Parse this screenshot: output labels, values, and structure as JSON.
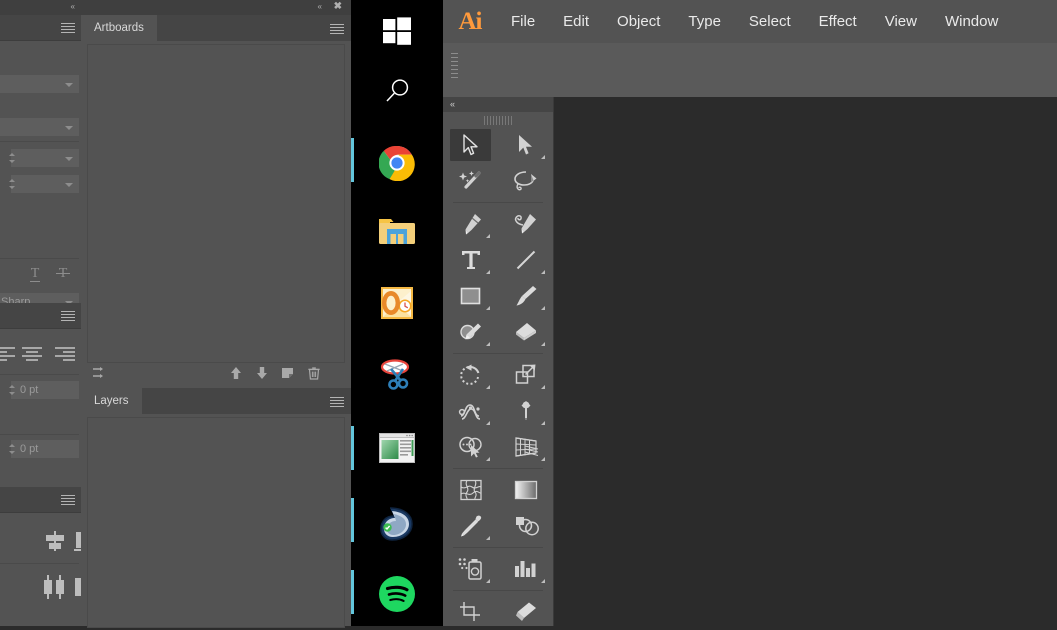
{
  "window": {
    "app_title": "Adobe Illustrator",
    "collapse_arrows": "«",
    "close_glyph": "✖"
  },
  "menubar": {
    "logo_text": "Ai",
    "items": [
      {
        "label": "File"
      },
      {
        "label": "Edit"
      },
      {
        "label": "Object"
      },
      {
        "label": "Type"
      },
      {
        "label": "Select"
      },
      {
        "label": "Effect"
      },
      {
        "label": "View"
      },
      {
        "label": "Window"
      }
    ]
  },
  "panel_group": {
    "tabs": [
      {
        "label": "Artboards",
        "active": true
      },
      {
        "label": "Layers",
        "active": true
      }
    ],
    "artboards_footer_icons": [
      {
        "name": "rearrange-artboards-icon"
      },
      {
        "name": "move-up-icon"
      },
      {
        "name": "move-down-icon"
      },
      {
        "name": "new-artboard-icon"
      },
      {
        "name": "delete-artboard-icon"
      }
    ]
  },
  "character_panel": {
    "font_family_value": "",
    "font_style_value": "",
    "font_size_value": "",
    "leading_value": "",
    "antialias_value": "Sharp",
    "underline_glyph": "T",
    "strikethrough_glyph": "T"
  },
  "paragraph_panel": {
    "indent_value": "0 pt",
    "space_value": "0 pt",
    "align_icons": [
      {
        "name": "align-left-icon"
      },
      {
        "name": "align-center-icon"
      },
      {
        "name": "align-right-icon"
      }
    ]
  },
  "align_panel": {
    "icons": [
      {
        "name": "horizontal-align-center-icon"
      },
      {
        "name": "vertical-align-bottom-icon"
      },
      {
        "name": "horizontal-distribute-center-icon"
      },
      {
        "name": "horizontal-distribute-space-icon"
      }
    ]
  },
  "toolbox": {
    "collapse_glyph": "«",
    "tools": [
      {
        "name": "selection-tool",
        "active": true,
        "has_flyout": false
      },
      {
        "name": "direct-selection-tool",
        "active": false,
        "has_flyout": true
      },
      {
        "name": "magic-wand-tool",
        "active": false,
        "has_flyout": false
      },
      {
        "name": "lasso-tool",
        "active": false,
        "has_flyout": false
      },
      {
        "name": "pen-tool",
        "active": false,
        "has_flyout": true
      },
      {
        "name": "curvature-tool",
        "active": false,
        "has_flyout": false
      },
      {
        "name": "type-tool",
        "active": false,
        "has_flyout": true
      },
      {
        "name": "line-segment-tool",
        "active": false,
        "has_flyout": true
      },
      {
        "name": "rectangle-tool",
        "active": false,
        "has_flyout": true
      },
      {
        "name": "paintbrush-tool",
        "active": false,
        "has_flyout": true
      },
      {
        "name": "shaper-tool",
        "active": false,
        "has_flyout": true
      },
      {
        "name": "eraser-tool",
        "active": false,
        "has_flyout": true
      },
      {
        "name": "rotate-tool",
        "active": false,
        "has_flyout": true
      },
      {
        "name": "scale-tool",
        "active": false,
        "has_flyout": true
      },
      {
        "name": "width-tool",
        "active": false,
        "has_flyout": true
      },
      {
        "name": "free-transform-tool",
        "active": false,
        "has_flyout": true
      },
      {
        "name": "shape-builder-tool",
        "active": false,
        "has_flyout": true
      },
      {
        "name": "perspective-grid-tool",
        "active": false,
        "has_flyout": true
      },
      {
        "name": "mesh-tool",
        "active": false,
        "has_flyout": false
      },
      {
        "name": "gradient-tool",
        "active": false,
        "has_flyout": false
      },
      {
        "name": "eyedropper-tool",
        "active": false,
        "has_flyout": true
      },
      {
        "name": "blend-tool",
        "active": false,
        "has_flyout": false
      },
      {
        "name": "symbol-sprayer-tool",
        "active": false,
        "has_flyout": true
      },
      {
        "name": "column-graph-tool",
        "active": false,
        "has_flyout": true
      },
      {
        "name": "artboard-tool",
        "active": false,
        "has_flyout": false
      },
      {
        "name": "slice-tool",
        "active": false,
        "has_flyout": false
      }
    ]
  },
  "taskbar": {
    "items": [
      {
        "name": "start-button",
        "label": "Start",
        "indicator": false
      },
      {
        "name": "search-button",
        "label": "Search",
        "indicator": false
      },
      {
        "name": "google-chrome",
        "label": "Google Chrome",
        "indicator": true
      },
      {
        "name": "file-explorer",
        "label": "File Explorer",
        "indicator": false
      },
      {
        "name": "microsoft-outlook",
        "label": "Microsoft Outlook",
        "indicator": false
      },
      {
        "name": "snipping-tool",
        "label": "Snipping Tool",
        "indicator": false
      },
      {
        "name": "powerpoint",
        "label": "Microsoft PowerPoint",
        "indicator": true
      },
      {
        "name": "adobe-acrobat",
        "label": "Adobe Acrobat",
        "indicator": true
      },
      {
        "name": "spotify",
        "label": "Spotify",
        "indicator": true
      }
    ]
  },
  "colors": {
    "panel_body": "#535353",
    "panel_header": "#454545",
    "canvas": "#2b2b2b",
    "taskbar": "#000000",
    "accent_indicator": "#63c6dd",
    "ai_orange": "#ff9a3c",
    "text": "#d8d8d8"
  }
}
